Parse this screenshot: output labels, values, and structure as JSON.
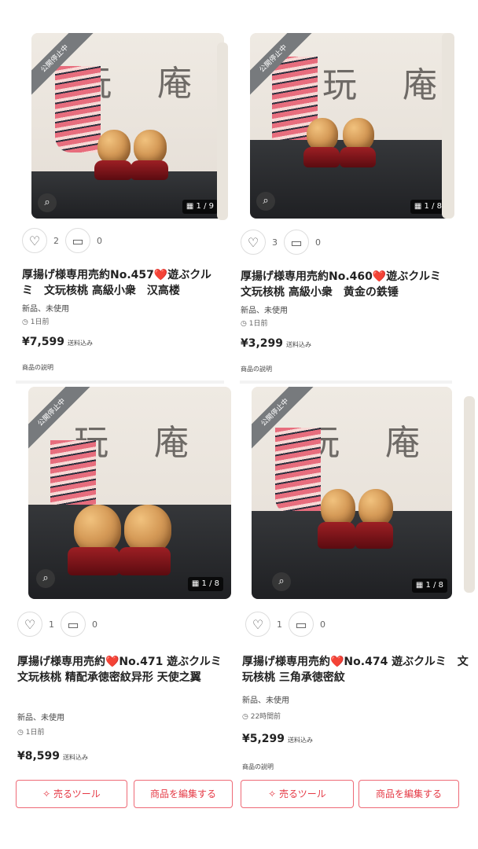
{
  "cards": [
    {
      "status_badge": "公開停止中",
      "image_counter": "1 / 9",
      "likes": "2",
      "comments": "0",
      "title": "厚揚げ様専用売約No.457❤️遊ぶクルミ　文玩核桃 高級小衆　汉高楼",
      "condition": "新品、未使用",
      "posted": "1日前",
      "price": "¥7,599",
      "shipping": "送料込み",
      "description_label": "商品の説明"
    },
    {
      "status_badge": "公開停止中",
      "image_counter": "1 / 8",
      "likes": "3",
      "comments": "0",
      "title": "厚揚げ様専用売約No.460❤️遊ぶクルミ　文玩核桃 高級小衆　黄金の鉄锤",
      "condition": "新品、未使用",
      "posted": "1日前",
      "price": "¥3,299",
      "shipping": "送料込み",
      "description_label": "商品の説明"
    },
    {
      "status_badge": "公開停止中",
      "image_counter": "1 / 8",
      "likes": "1",
      "comments": "0",
      "title": "厚揚げ様専用売約❤️No.471 遊ぶクルミ　文玩核桃 精配承徳密紋异形 天使之翼",
      "condition": "新品、未使用",
      "posted": "1日前",
      "price": "¥8,599",
      "shipping": "送料込み"
    },
    {
      "status_badge": "公開停止中",
      "image_counter": "1 / 8",
      "likes": "1",
      "comments": "0",
      "title": "厚揚げ様専用売約❤️No.474 遊ぶクルミ　文玩核桃 三角承徳密紋",
      "condition": "新品、未使用",
      "posted": "22時間前",
      "price": "¥5,299",
      "shipping": "送料込み",
      "description_label": "商品の説明"
    }
  ],
  "actions": {
    "sell_tool": "売るツール",
    "edit_item": "商品を編集する"
  },
  "photo_text": "玩 庵",
  "icons": {
    "heart": "heart-outline-icon",
    "comment": "comment-icon",
    "clock": "clock-icon",
    "scan": "image-search-icon",
    "grid": "grid-icon",
    "tool": "magic-tool-icon"
  },
  "colors": {
    "accent": "#e53945",
    "badge": "#777a7d"
  }
}
